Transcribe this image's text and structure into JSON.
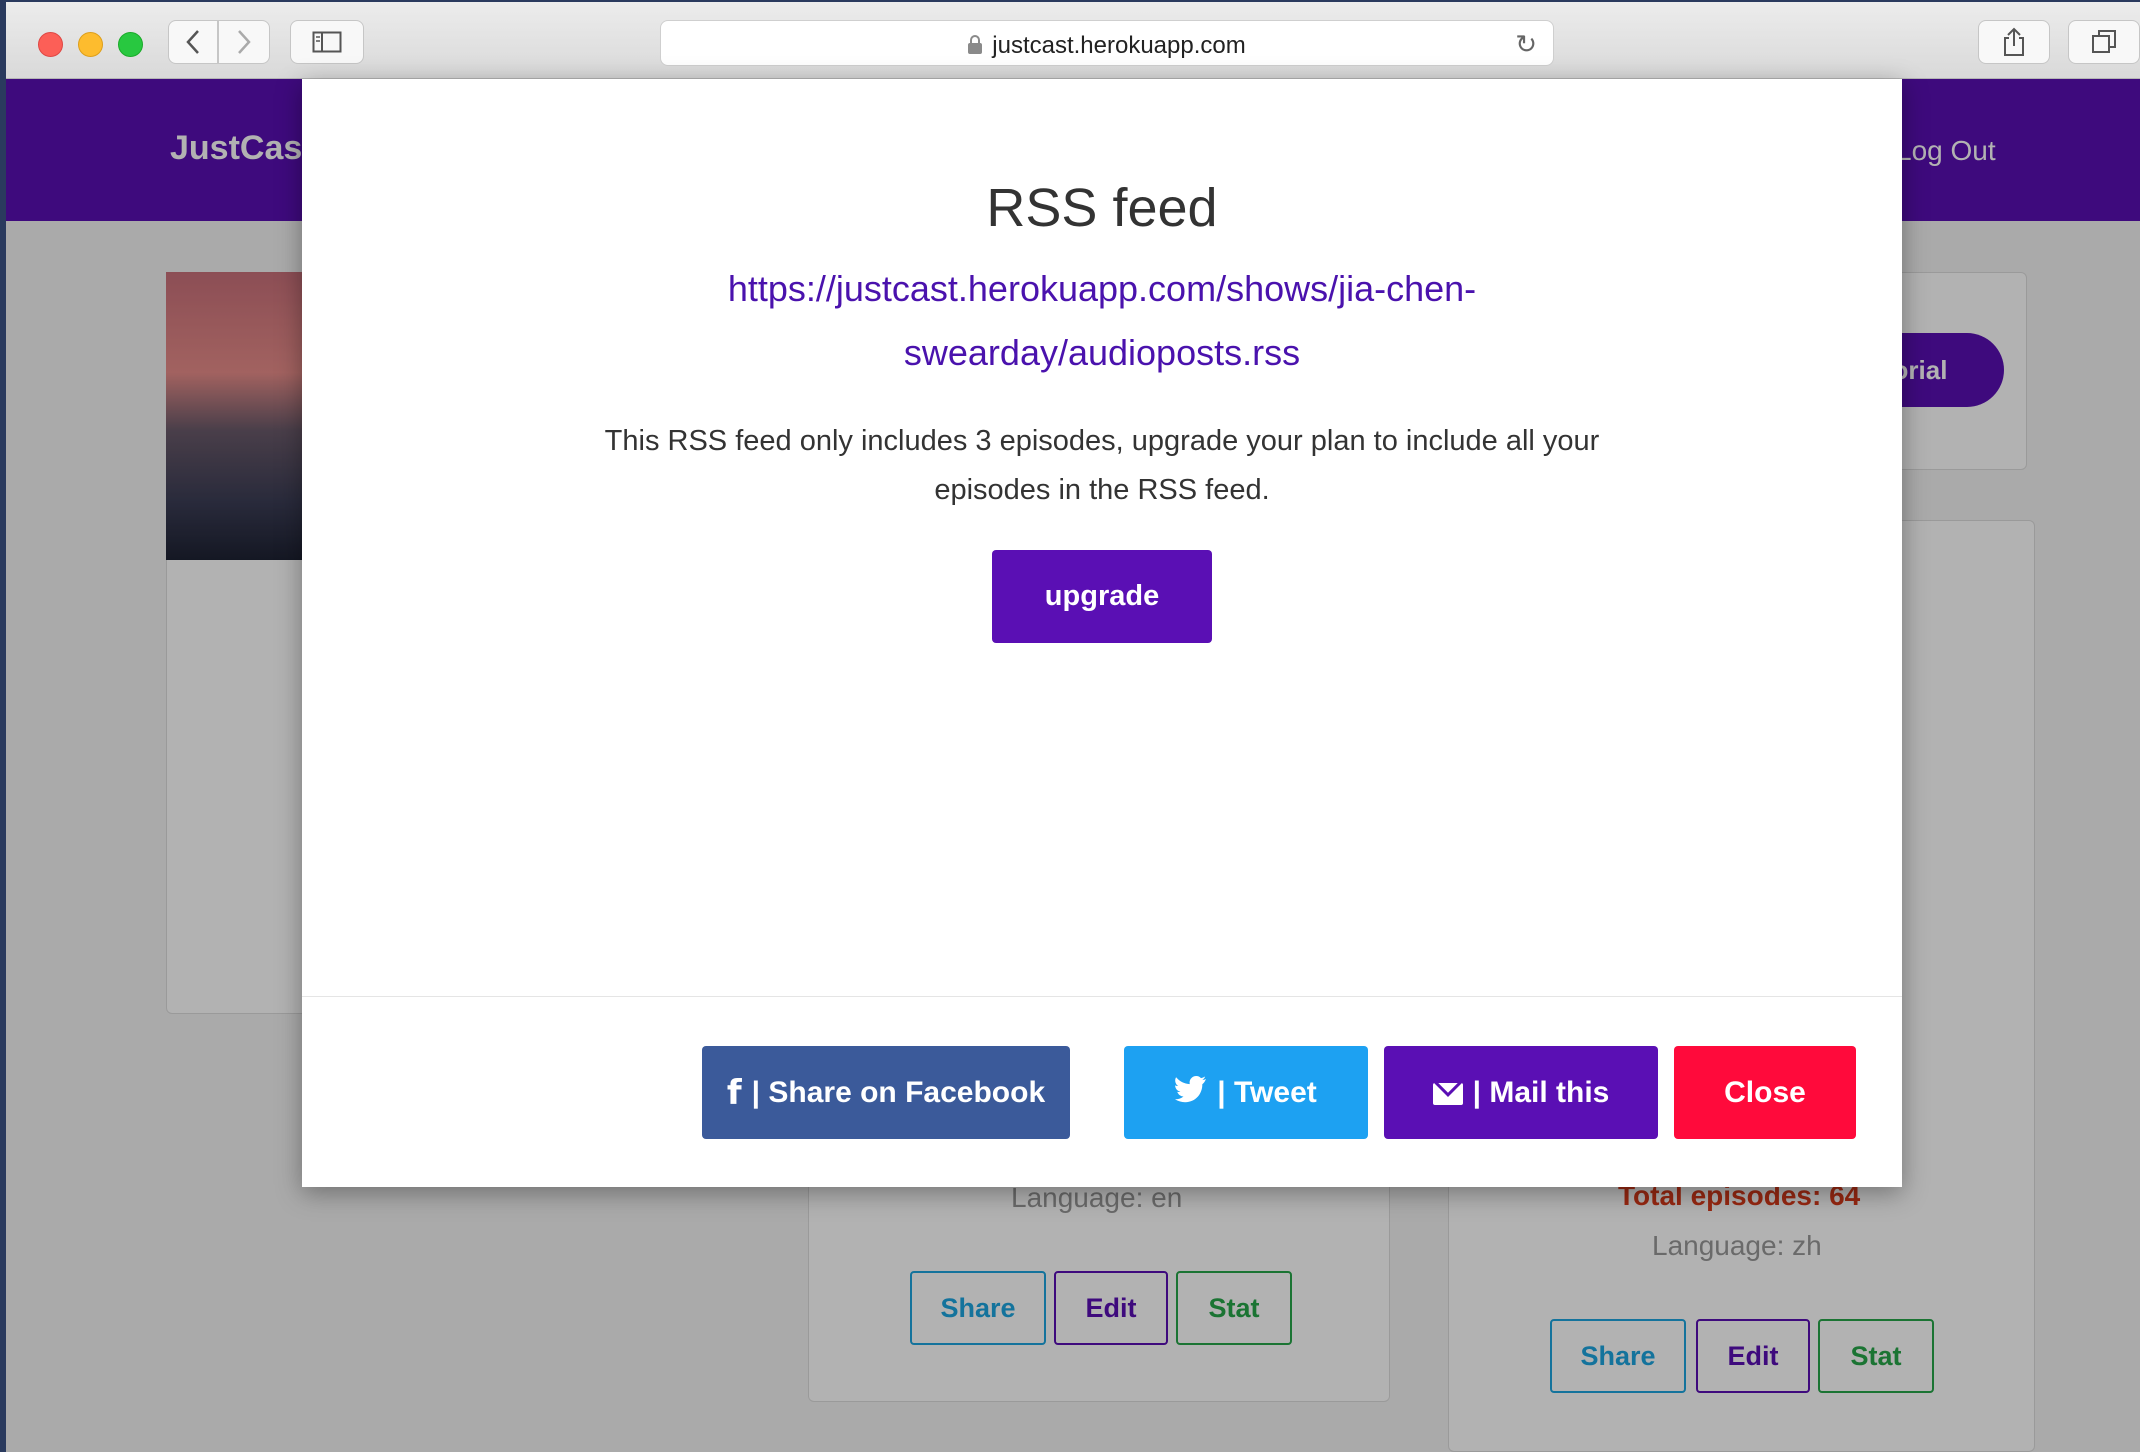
{
  "browser": {
    "url": "justcast.herokuapp.com"
  },
  "background_page": {
    "brand": "JustCas",
    "logout_label": "Log Out",
    "tutorial_label": "utorial",
    "mid_card": {
      "language": "Language: en",
      "share_label": "Share",
      "edit_label": "Edit",
      "stat_label": "Stat"
    },
    "right_card": {
      "total_episodes": "Total episodes: 64",
      "language": "Language: zh",
      "share_label": "Share",
      "edit_label": "Edit",
      "stat_label": "Stat"
    }
  },
  "modal": {
    "title": "RSS feed",
    "feed_url": "https://justcast.herokuapp.com/shows/jia-chen-swearday/audioposts.rss",
    "notice": "This RSS feed only includes 3 episodes, upgrade your plan to include all your episodes in the RSS feed.",
    "upgrade_label": "upgrade",
    "footer": {
      "facebook_label": "| Share on Facebook",
      "tweet_label": "| Tweet",
      "mail_label": "| Mail this",
      "close_label": "Close"
    }
  },
  "colors": {
    "brand_purple": "#5a0fb4",
    "facebook_blue": "#3b5a9a",
    "twitter_blue": "#1da1f2",
    "close_red": "#ff0a3b",
    "link_purple": "#4a12ad",
    "total_red": "#d93a1a"
  }
}
